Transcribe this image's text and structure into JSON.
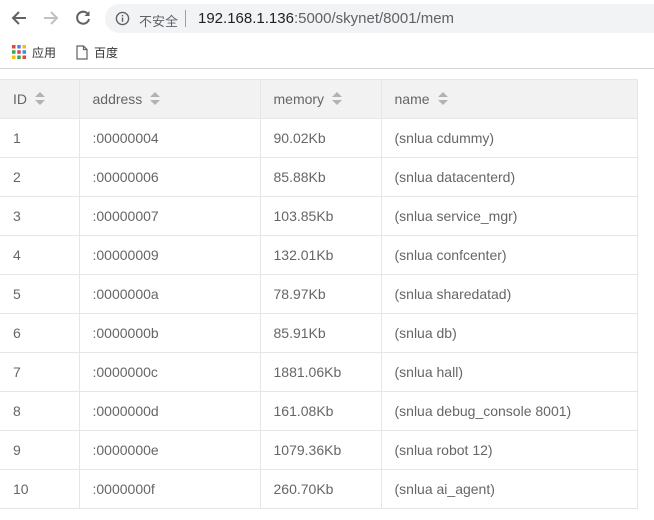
{
  "browser": {
    "security_label": "不安全",
    "url_host": "192.168.1.136",
    "url_path": ":5000/skynet/8001/mem",
    "back_icon": "arrow-left-icon",
    "forward_icon": "arrow-right-icon",
    "reload_icon": "reload-icon",
    "info_icon": "info-icon"
  },
  "bookmarks": [
    {
      "label": "应用",
      "icon": "apps-grid-icon"
    },
    {
      "label": "百度",
      "icon": "page-icon"
    }
  ],
  "table": {
    "headers": [
      "ID",
      "address",
      "memory",
      "name"
    ],
    "rows": [
      [
        "1",
        ":00000004",
        "90.02Kb",
        "(snlua cdummy)"
      ],
      [
        "2",
        ":00000006",
        "85.88Kb",
        "(snlua datacenterd)"
      ],
      [
        "3",
        ":00000007",
        "103.85Kb",
        "(snlua service_mgr)"
      ],
      [
        "4",
        ":00000009",
        "132.01Kb",
        "(snlua confcenter)"
      ],
      [
        "5",
        ":0000000a",
        "78.97Kb",
        "(snlua sharedatad)"
      ],
      [
        "6",
        ":0000000b",
        "85.91Kb",
        "(snlua db)"
      ],
      [
        "7",
        ":0000000c",
        "1881.06Kb",
        "(snlua hall)"
      ],
      [
        "8",
        ":0000000d",
        "161.08Kb",
        "(snlua debug_console 8001)"
      ],
      [
        "9",
        ":0000000e",
        "1079.36Kb",
        "(snlua robot 12)"
      ],
      [
        "10",
        ":0000000f",
        "260.70Kb",
        "(snlua ai_agent)"
      ]
    ]
  }
}
